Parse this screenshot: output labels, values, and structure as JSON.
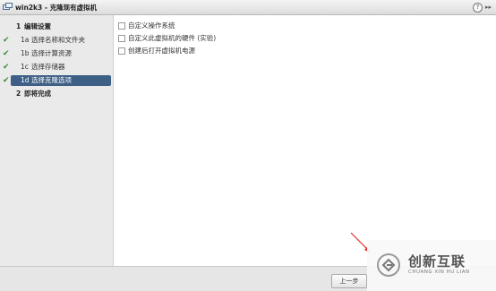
{
  "window": {
    "title": "win2k3 - 克隆现有虚拟机",
    "help_label": "?",
    "expand_label": "▸▸"
  },
  "steps": [
    {
      "number": "1",
      "label": "编辑设置",
      "checked": false,
      "group": true,
      "selected": false
    },
    {
      "number": "1a",
      "label": "选择名称和文件夹",
      "checked": true,
      "group": false,
      "selected": false
    },
    {
      "number": "1b",
      "label": "选择计算资源",
      "checked": true,
      "group": false,
      "selected": false
    },
    {
      "number": "1c",
      "label": "选择存储器",
      "checked": true,
      "group": false,
      "selected": false
    },
    {
      "number": "1d",
      "label": "选择克隆选项",
      "checked": true,
      "group": false,
      "selected": true
    },
    {
      "number": "2",
      "label": "即将完成",
      "checked": false,
      "group": true,
      "selected": false
    }
  ],
  "options": [
    {
      "label": "自定义操作系统",
      "checked": false
    },
    {
      "label": "自定义此虚拟机的硬件 (实验)",
      "checked": false
    },
    {
      "label": "创建后打开虚拟机电源",
      "checked": false
    }
  ],
  "footer": {
    "back_label": "上一步"
  },
  "watermark": {
    "name": "创新互联",
    "sub": "CHUANG XIN HU LIAN"
  },
  "colors": {
    "selected_step": "#3e5f86",
    "check": "#3a8e3a",
    "arrow": "#e03030"
  },
  "icons": {
    "app": "vm-clone-icon",
    "check": "check-icon",
    "help": "help-icon",
    "expand": "expand-icon"
  }
}
